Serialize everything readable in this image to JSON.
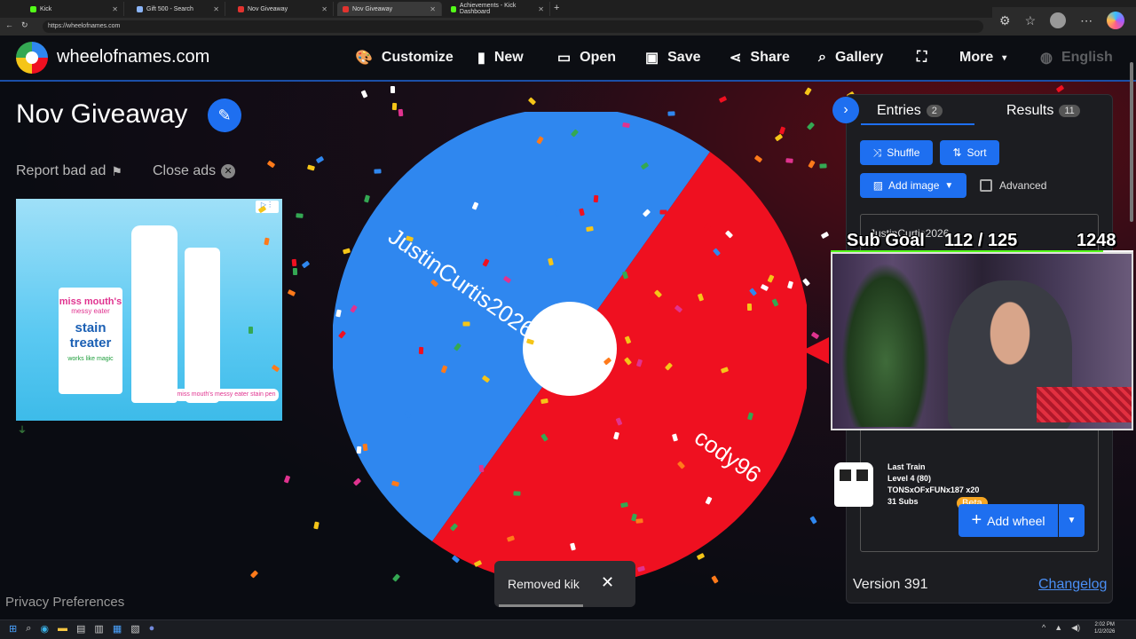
{
  "browser": {
    "tabs": [
      {
        "title": "Kick",
        "color": "#53fc18"
      },
      {
        "title": "Gift 500 - Search",
        "color": "#8ab4f8"
      },
      {
        "title": "Nov Giveaway",
        "color": "#e2332f"
      },
      {
        "title": "Nov Giveaway",
        "color": "#e2332f"
      },
      {
        "title": "Achievements - Kick Dashboard",
        "color": "#53fc18"
      }
    ],
    "url": "https://wheelofnames.com"
  },
  "header": {
    "site_name": "wheelofnames.com",
    "nav": [
      "Customize",
      "New",
      "Open",
      "Save",
      "Share",
      "Gallery",
      "More",
      "English"
    ]
  },
  "page": {
    "title": "Nov Giveaway",
    "report_ad": "Report bad ad",
    "close_ads": "Close ads",
    "privacy": "Privacy Preferences"
  },
  "ad": {
    "brand": "miss mouth's",
    "line1": "messy eater",
    "product": "stain treater",
    "tag": "works like magic",
    "pen_label": "miss mouth's messy eater stain pen"
  },
  "wheel": {
    "slices": [
      {
        "name": "JustinCurtis2026",
        "color": "#2f87ef"
      },
      {
        "name": "cody96",
        "color": "#ef1020"
      }
    ]
  },
  "panel": {
    "tab_entries": "Entries",
    "entries_count": "2",
    "tab_results": "Results",
    "results_count": "11",
    "shuffle": "Shuffle",
    "sort": "Sort",
    "add_image": "Add image",
    "advanced": "Advanced",
    "entry_text": "JustinCurtis2026",
    "beta": "Beta",
    "add_wheel": "Add wheel",
    "version": "Version 391",
    "changelog": "Changelog"
  },
  "overlay": {
    "sub_goal": "Sub Goal",
    "sub_count": "112 / 125",
    "number": "1248",
    "last_train": "Last Train",
    "level": "Level 4  (80)",
    "user": "TONSxOFxFUNx187 x20",
    "subs": "31 Subs"
  },
  "toast": {
    "text": "Removed kik"
  },
  "taskbar": {
    "time": "2:02 PM",
    "date": "1/2/2026"
  }
}
